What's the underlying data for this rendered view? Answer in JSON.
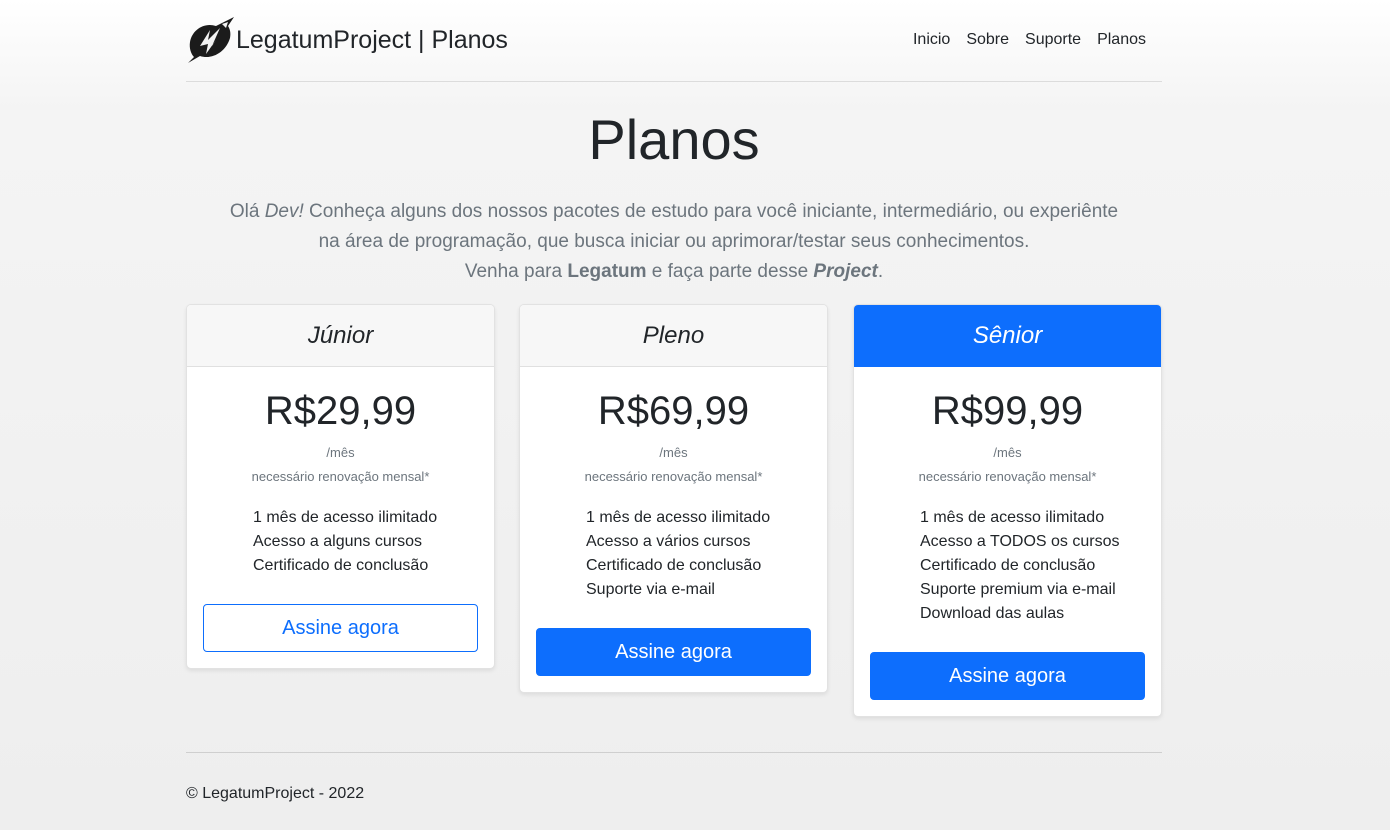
{
  "header": {
    "brand": "LegatumProject | Planos",
    "nav": [
      "Inicio",
      "Sobre",
      "Suporte",
      "Planos"
    ]
  },
  "hero": {
    "title": "Planos",
    "lead_part1": "Olá ",
    "lead_dev": "Dev!",
    "lead_part2": " Conheça alguns dos nossos pacotes de estudo para você iniciante, intermediário, ou experiênte",
    "lead_line2": "na área de programação, que busca iniciar ou aprimorar/testar seus conhecimentos.",
    "lead_line3_a": "Venha para ",
    "lead_line3_b": "Legatum",
    "lead_line3_c": " e faça parte desse ",
    "lead_line3_d": "Project",
    "lead_line3_e": "."
  },
  "plans": [
    {
      "name": "Júnior",
      "price": "R$29,99",
      "period": "/mês",
      "note": "necessário renovação mensal*",
      "features": [
        "1 mês de acesso ilimitado",
        "Acesso a alguns cursos",
        "Certificado de conclusão"
      ],
      "button": "Assine agora"
    },
    {
      "name": "Pleno",
      "price": "R$69,99",
      "period": "/mês",
      "note": "necessário renovação mensal*",
      "features": [
        "1 mês de acesso ilimitado",
        "Acesso a vários cursos",
        "Certificado de conclusão",
        "Suporte via e-mail"
      ],
      "button": "Assine agora"
    },
    {
      "name": "Sênior",
      "price": "R$99,99",
      "period": "/mês",
      "note": "necessário renovação mensal*",
      "features": [
        "1 mês de acesso ilimitado",
        "Acesso a TODOS os cursos",
        "Certificado de conclusão",
        "Suporte premium via e-mail",
        "Download das aulas"
      ],
      "button": "Assine agora"
    }
  ],
  "footer": {
    "text": "© LegatumProject - 2022"
  },
  "colors": {
    "primary": "#0d6efd",
    "muted": "#6c757d",
    "text": "#212529"
  },
  "icons": {
    "brand_logo": "legatum-logo-icon"
  }
}
